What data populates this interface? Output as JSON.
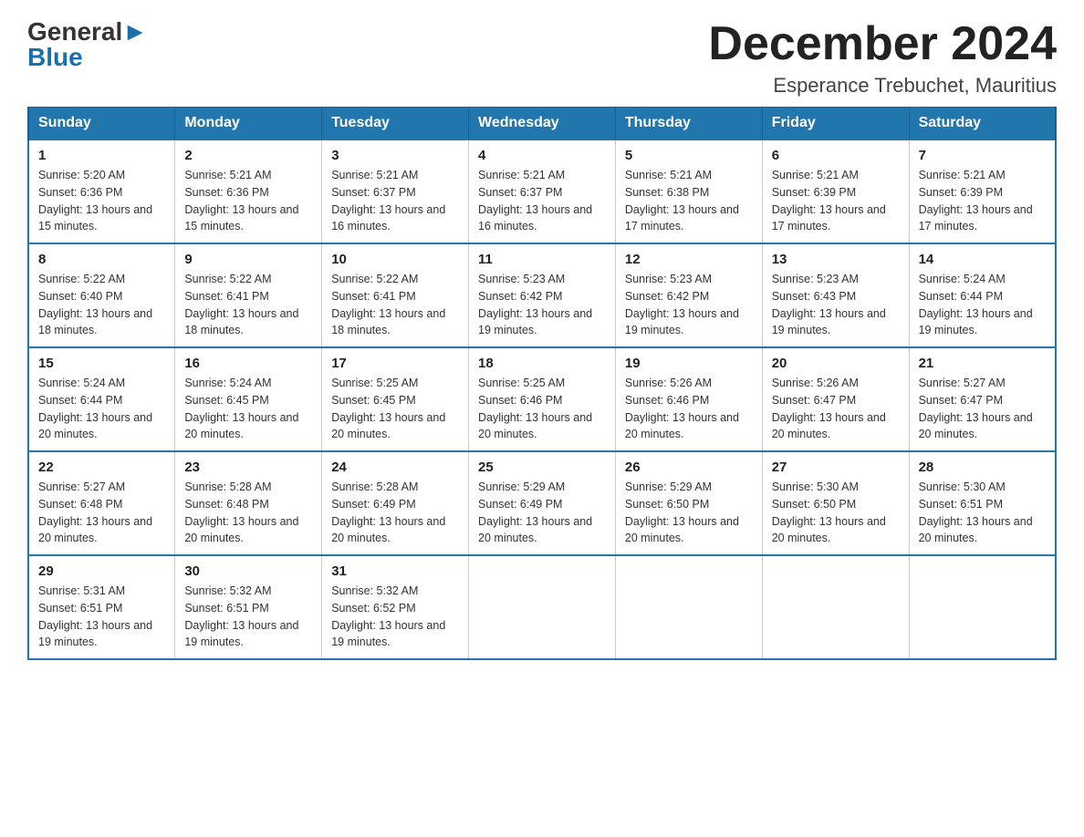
{
  "logo": {
    "line1_black": "General",
    "line1_blue": "Blue",
    "line2": "Blue"
  },
  "title": "December 2024",
  "location": "Esperance Trebuchet, Mauritius",
  "headers": [
    "Sunday",
    "Monday",
    "Tuesday",
    "Wednesday",
    "Thursday",
    "Friday",
    "Saturday"
  ],
  "weeks": [
    [
      {
        "day": "1",
        "sunrise": "Sunrise: 5:20 AM",
        "sunset": "Sunset: 6:36 PM",
        "daylight": "Daylight: 13 hours and 15 minutes."
      },
      {
        "day": "2",
        "sunrise": "Sunrise: 5:21 AM",
        "sunset": "Sunset: 6:36 PM",
        "daylight": "Daylight: 13 hours and 15 minutes."
      },
      {
        "day": "3",
        "sunrise": "Sunrise: 5:21 AM",
        "sunset": "Sunset: 6:37 PM",
        "daylight": "Daylight: 13 hours and 16 minutes."
      },
      {
        "day": "4",
        "sunrise": "Sunrise: 5:21 AM",
        "sunset": "Sunset: 6:37 PM",
        "daylight": "Daylight: 13 hours and 16 minutes."
      },
      {
        "day": "5",
        "sunrise": "Sunrise: 5:21 AM",
        "sunset": "Sunset: 6:38 PM",
        "daylight": "Daylight: 13 hours and 17 minutes."
      },
      {
        "day": "6",
        "sunrise": "Sunrise: 5:21 AM",
        "sunset": "Sunset: 6:39 PM",
        "daylight": "Daylight: 13 hours and 17 minutes."
      },
      {
        "day": "7",
        "sunrise": "Sunrise: 5:21 AM",
        "sunset": "Sunset: 6:39 PM",
        "daylight": "Daylight: 13 hours and 17 minutes."
      }
    ],
    [
      {
        "day": "8",
        "sunrise": "Sunrise: 5:22 AM",
        "sunset": "Sunset: 6:40 PM",
        "daylight": "Daylight: 13 hours and 18 minutes."
      },
      {
        "day": "9",
        "sunrise": "Sunrise: 5:22 AM",
        "sunset": "Sunset: 6:41 PM",
        "daylight": "Daylight: 13 hours and 18 minutes."
      },
      {
        "day": "10",
        "sunrise": "Sunrise: 5:22 AM",
        "sunset": "Sunset: 6:41 PM",
        "daylight": "Daylight: 13 hours and 18 minutes."
      },
      {
        "day": "11",
        "sunrise": "Sunrise: 5:23 AM",
        "sunset": "Sunset: 6:42 PM",
        "daylight": "Daylight: 13 hours and 19 minutes."
      },
      {
        "day": "12",
        "sunrise": "Sunrise: 5:23 AM",
        "sunset": "Sunset: 6:42 PM",
        "daylight": "Daylight: 13 hours and 19 minutes."
      },
      {
        "day": "13",
        "sunrise": "Sunrise: 5:23 AM",
        "sunset": "Sunset: 6:43 PM",
        "daylight": "Daylight: 13 hours and 19 minutes."
      },
      {
        "day": "14",
        "sunrise": "Sunrise: 5:24 AM",
        "sunset": "Sunset: 6:44 PM",
        "daylight": "Daylight: 13 hours and 19 minutes."
      }
    ],
    [
      {
        "day": "15",
        "sunrise": "Sunrise: 5:24 AM",
        "sunset": "Sunset: 6:44 PM",
        "daylight": "Daylight: 13 hours and 20 minutes."
      },
      {
        "day": "16",
        "sunrise": "Sunrise: 5:24 AM",
        "sunset": "Sunset: 6:45 PM",
        "daylight": "Daylight: 13 hours and 20 minutes."
      },
      {
        "day": "17",
        "sunrise": "Sunrise: 5:25 AM",
        "sunset": "Sunset: 6:45 PM",
        "daylight": "Daylight: 13 hours and 20 minutes."
      },
      {
        "day": "18",
        "sunrise": "Sunrise: 5:25 AM",
        "sunset": "Sunset: 6:46 PM",
        "daylight": "Daylight: 13 hours and 20 minutes."
      },
      {
        "day": "19",
        "sunrise": "Sunrise: 5:26 AM",
        "sunset": "Sunset: 6:46 PM",
        "daylight": "Daylight: 13 hours and 20 minutes."
      },
      {
        "day": "20",
        "sunrise": "Sunrise: 5:26 AM",
        "sunset": "Sunset: 6:47 PM",
        "daylight": "Daylight: 13 hours and 20 minutes."
      },
      {
        "day": "21",
        "sunrise": "Sunrise: 5:27 AM",
        "sunset": "Sunset: 6:47 PM",
        "daylight": "Daylight: 13 hours and 20 minutes."
      }
    ],
    [
      {
        "day": "22",
        "sunrise": "Sunrise: 5:27 AM",
        "sunset": "Sunset: 6:48 PM",
        "daylight": "Daylight: 13 hours and 20 minutes."
      },
      {
        "day": "23",
        "sunrise": "Sunrise: 5:28 AM",
        "sunset": "Sunset: 6:48 PM",
        "daylight": "Daylight: 13 hours and 20 minutes."
      },
      {
        "day": "24",
        "sunrise": "Sunrise: 5:28 AM",
        "sunset": "Sunset: 6:49 PM",
        "daylight": "Daylight: 13 hours and 20 minutes."
      },
      {
        "day": "25",
        "sunrise": "Sunrise: 5:29 AM",
        "sunset": "Sunset: 6:49 PM",
        "daylight": "Daylight: 13 hours and 20 minutes."
      },
      {
        "day": "26",
        "sunrise": "Sunrise: 5:29 AM",
        "sunset": "Sunset: 6:50 PM",
        "daylight": "Daylight: 13 hours and 20 minutes."
      },
      {
        "day": "27",
        "sunrise": "Sunrise: 5:30 AM",
        "sunset": "Sunset: 6:50 PM",
        "daylight": "Daylight: 13 hours and 20 minutes."
      },
      {
        "day": "28",
        "sunrise": "Sunrise: 5:30 AM",
        "sunset": "Sunset: 6:51 PM",
        "daylight": "Daylight: 13 hours and 20 minutes."
      }
    ],
    [
      {
        "day": "29",
        "sunrise": "Sunrise: 5:31 AM",
        "sunset": "Sunset: 6:51 PM",
        "daylight": "Daylight: 13 hours and 19 minutes."
      },
      {
        "day": "30",
        "sunrise": "Sunrise: 5:32 AM",
        "sunset": "Sunset: 6:51 PM",
        "daylight": "Daylight: 13 hours and 19 minutes."
      },
      {
        "day": "31",
        "sunrise": "Sunrise: 5:32 AM",
        "sunset": "Sunset: 6:52 PM",
        "daylight": "Daylight: 13 hours and 19 minutes."
      },
      null,
      null,
      null,
      null
    ]
  ]
}
